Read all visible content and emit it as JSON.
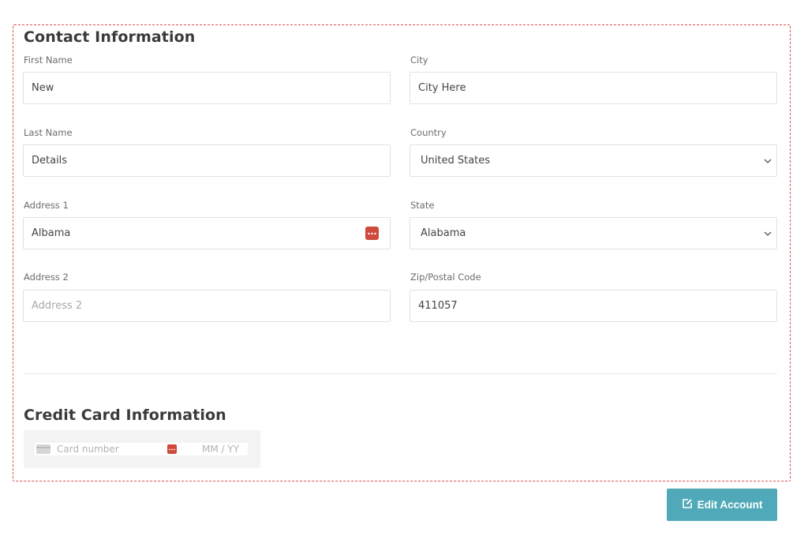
{
  "contact": {
    "title": "Contact Information",
    "first_name": {
      "label": "First Name",
      "value": "New"
    },
    "last_name": {
      "label": "Last Name",
      "value": "Details"
    },
    "address1": {
      "label": "Address 1",
      "value": "Albama"
    },
    "address2": {
      "label": "Address 2",
      "placeholder": "Address 2"
    },
    "city": {
      "label": "City",
      "value": "City Here"
    },
    "country": {
      "label": "Country",
      "value": "United States"
    },
    "state": {
      "label": "State",
      "value": "Alabama"
    },
    "zip": {
      "label": "Zip/Postal Code",
      "value": "411057"
    }
  },
  "card": {
    "title": "Credit Card Information",
    "number_placeholder": "Card number",
    "expiry_placeholder": "MM / YY"
  },
  "actions": {
    "edit_label": "Edit Account",
    "edit_icon": "edit-icon"
  },
  "colors": {
    "accent": "#4fa9b8",
    "frame_border": "#d9534f",
    "password_manager_icon": "#cf4a3c"
  }
}
